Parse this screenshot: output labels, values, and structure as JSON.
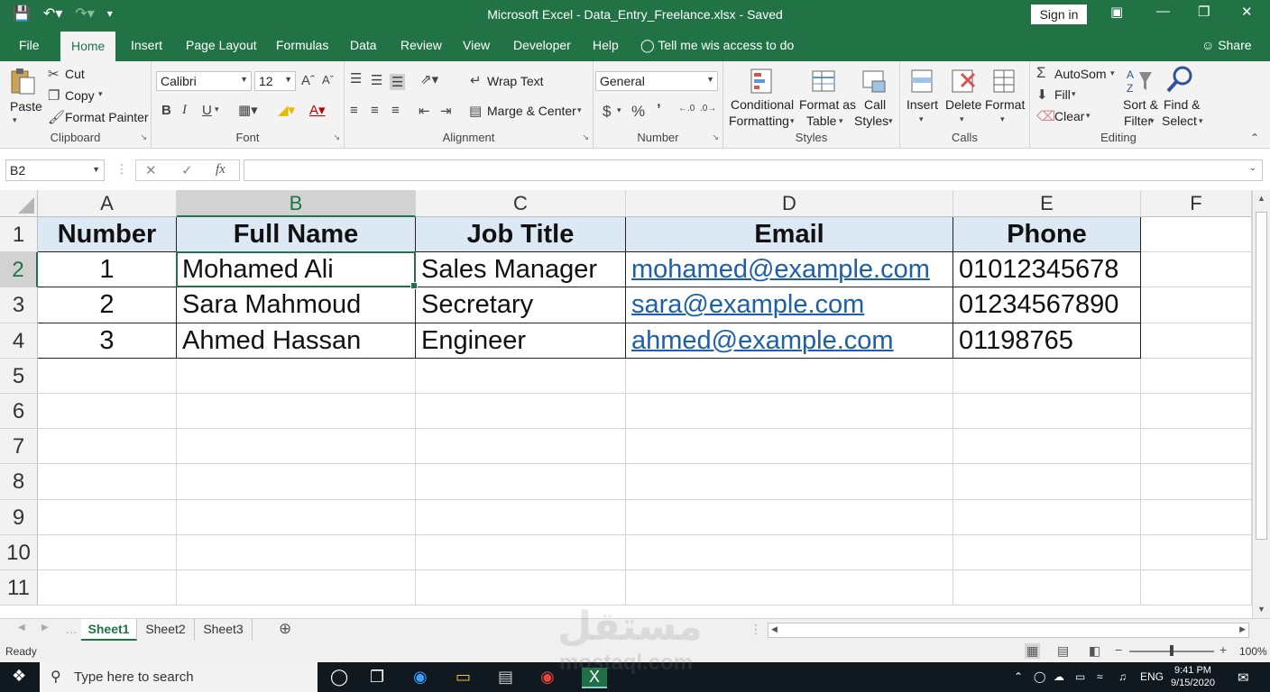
{
  "window": {
    "title": "Microsoft Excel - Data_Entry_Freelance.xlsx - Saved",
    "sign_in": "Sign in"
  },
  "tabs": [
    "File",
    "Home",
    "Insert",
    "Page Layout",
    "Formulas",
    "Data",
    "Review",
    "View",
    "Developer",
    "Help"
  ],
  "tell_me": "Tell me wis access to do",
  "share": "Share",
  "ribbon": {
    "clipboard": {
      "label": "Clipboard",
      "paste": "Paste",
      "cut": "Cut",
      "copy": "Copy",
      "format_painter": "Format Painter"
    },
    "font": {
      "label": "Font",
      "font_name": "Calibri",
      "font_size": "12",
      "bold": "B",
      "italic": "I",
      "underline": "U"
    },
    "alignment": {
      "label": "Alignment",
      "wrap_text": "Wrap Text",
      "merge_center": "Marge & Center"
    },
    "number": {
      "label": "Number",
      "format": "General",
      "currency": "$",
      "percent": "%",
      "comma": "ʼ"
    },
    "styles": {
      "label": "Styles",
      "conditional_1": "Conditional",
      "conditional_2": "Formatting",
      "format_table_1": "Format as",
      "format_table_2": "Table",
      "cell_styles_1": "Call",
      "cell_styles_2": "Styles"
    },
    "cells": {
      "label": "Calls",
      "insert": "Insert",
      "delete": "Delete",
      "format": "Format"
    },
    "editing": {
      "label": "Editing",
      "autosum": "AutoSom",
      "fill": "Fill",
      "clear": "Clear",
      "sort_1": "Sort &",
      "sort_2": "Filter",
      "find_1": "Find &",
      "find_2": "Select"
    }
  },
  "formula_bar": {
    "name_box": "B2",
    "content": ""
  },
  "sheet": {
    "columns": [
      "A",
      "B",
      "C",
      "D",
      "E",
      "F"
    ],
    "rows": [
      "1",
      "2",
      "3",
      "4",
      "5",
      "6",
      "7",
      "8",
      "9",
      "10",
      "11"
    ],
    "headers": [
      "Number",
      "Full Name",
      "Job Title",
      "Email",
      "Phone"
    ],
    "data": [
      [
        "1",
        "Mohamed Ali",
        "Sales Manager",
        "mohamed@example.com",
        "01012345678"
      ],
      [
        "2",
        "Sara Mahmoud",
        "Secretary",
        "sara@example.com",
        "01234567890"
      ],
      [
        "3",
        "Ahmed Hassan",
        "Engineer",
        "ahmed@example.com",
        "01198765"
      ]
    ],
    "selected_cell": "B2"
  },
  "sheet_tabs": [
    "Sheet1",
    "Sheet2",
    "Sheet3"
  ],
  "status": {
    "ready": "Ready",
    "zoom": "100%"
  },
  "taskbar": {
    "search_placeholder": "Type here to search",
    "lang": "ENG",
    "time": "9:41 PM",
    "date": "9/15/2020"
  },
  "watermark": {
    "arabic": "مستقل",
    "latin": "mostaql.com"
  },
  "colors": {
    "excel_green": "#217346",
    "header_fill": "#dce9f4",
    "link": "#1f5fa8"
  }
}
